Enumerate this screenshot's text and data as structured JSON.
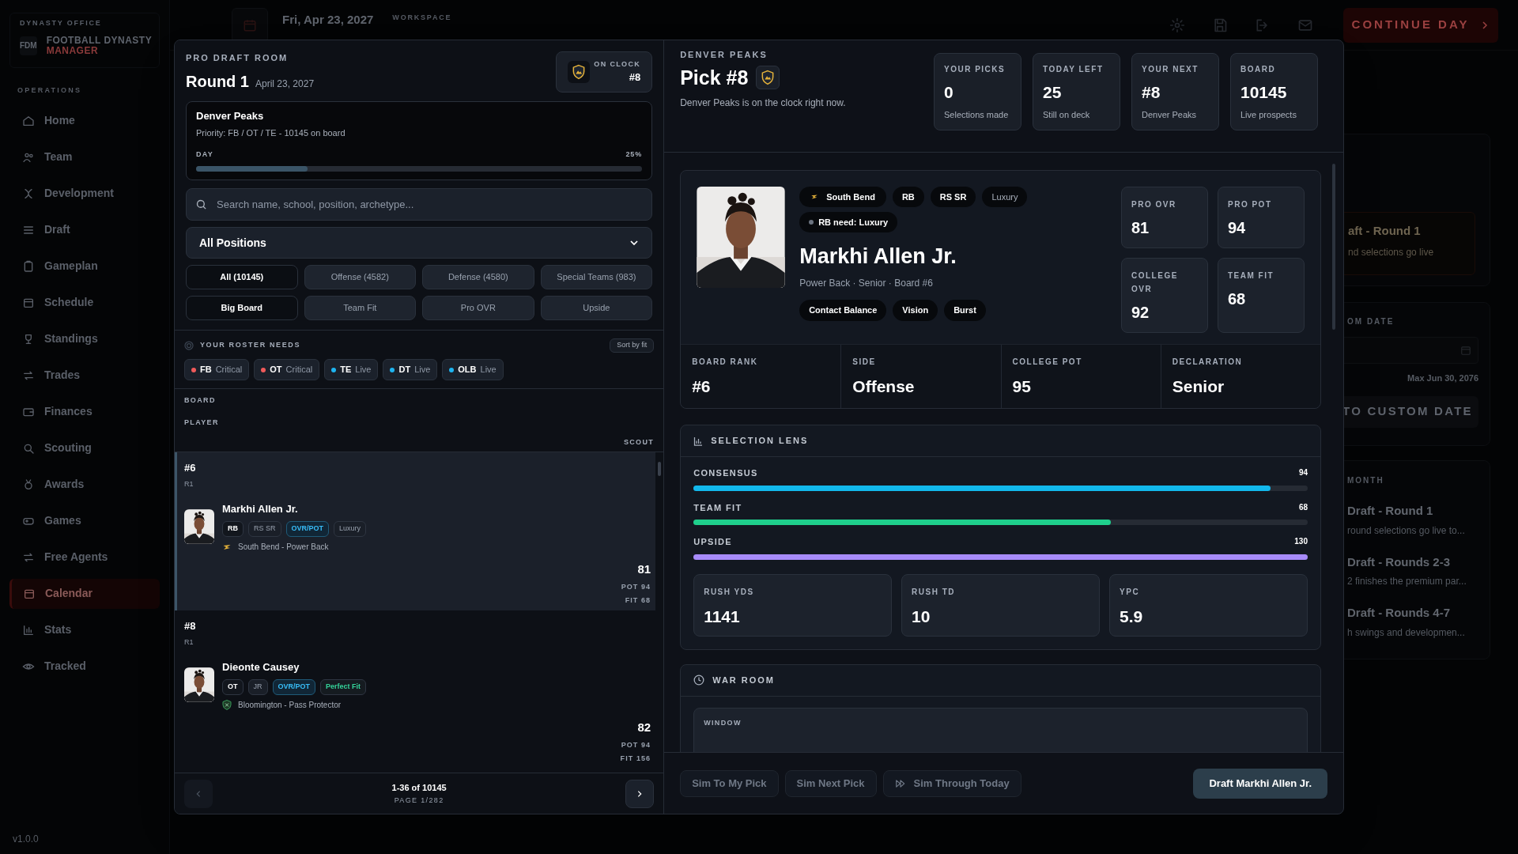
{
  "app": {
    "kicker": "DYNASTY OFFICE",
    "logo": "FDM",
    "brand": "FOOTBALL DYNASTY",
    "brand_sub": "MANAGER",
    "nav_heading": "OPERATIONS",
    "nav": [
      {
        "label": "Home",
        "selected": false
      },
      {
        "label": "Team",
        "selected": false
      },
      {
        "label": "Development",
        "selected": false
      },
      {
        "label": "Draft",
        "selected": false
      },
      {
        "label": "Gameplan",
        "selected": false
      },
      {
        "label": "Schedule",
        "selected": false
      },
      {
        "label": "Standings",
        "selected": false
      },
      {
        "label": "Trades",
        "selected": false
      },
      {
        "label": "Finances",
        "selected": false
      },
      {
        "label": "Scouting",
        "selected": false
      },
      {
        "label": "Awards",
        "selected": false
      },
      {
        "label": "Games",
        "selected": false
      },
      {
        "label": "Free Agents",
        "selected": false
      },
      {
        "label": "Calendar",
        "selected": true
      },
      {
        "label": "Stats",
        "selected": false
      },
      {
        "label": "Tracked",
        "selected": false
      }
    ],
    "version": "v1.0.0"
  },
  "top_bar": {
    "date": "Fri, Apr 23, 2027",
    "workspace_label": "WORKSPACE",
    "continue_button": "CONTINUE DAY"
  },
  "calendar_panel": {
    "event": {
      "title": "aft - Round 1",
      "note": "nd selections go live"
    },
    "custom_date": {
      "heading": "OM DATE",
      "hint": "Max Jun 30, 2076",
      "button": "TO CUSTOM DATE"
    },
    "month": {
      "heading": "MONTH",
      "events": [
        {
          "title": "Draft - Round 1",
          "note": "round selections go live to..."
        },
        {
          "title": "Draft - Rounds 2-3",
          "note": "2 finishes the premium par..."
        },
        {
          "title": "Draft - Rounds 4-7",
          "note": "h swings and developmen..."
        }
      ]
    }
  },
  "draft_room": {
    "kicker": "PRO DRAFT ROOM",
    "title": "Round 1",
    "date": "April 23, 2027",
    "on_clock": {
      "label": "ON CLOCK",
      "pick": "#8"
    },
    "team": {
      "name": "Denver Peaks",
      "priority": "Priority: FB / OT / TE - 10145 on board",
      "day_label": "DAY",
      "day_reading": "25%",
      "level": 0.25
    },
    "search": {
      "placeholder": "Search name, school, position, archetype..."
    },
    "position_select": "All Positions",
    "filters": [
      {
        "label": "All (10145)",
        "selected": true
      },
      {
        "label": "Offense (4582)",
        "selected": false
      },
      {
        "label": "Defense (4580)",
        "selected": false
      },
      {
        "label": "Special Teams (983)",
        "selected": false
      }
    ],
    "sorts": [
      {
        "label": "Big Board",
        "selected": true
      },
      {
        "label": "Team Fit",
        "selected": false
      },
      {
        "label": "Pro OVR",
        "selected": false
      },
      {
        "label": "Upside",
        "selected": false
      }
    ],
    "needs": {
      "heading": "YOUR ROSTER NEEDS",
      "sort_button": "Sort by fit",
      "items": [
        {
          "position": "FB",
          "status": "Critical",
          "color": "#f05a5a"
        },
        {
          "position": "OT",
          "status": "Critical",
          "color": "#f05a5a"
        },
        {
          "position": "TE",
          "status": "Live",
          "color": "#1eb4f0"
        },
        {
          "position": "DT",
          "status": "Live",
          "color": "#1eb4f0"
        },
        {
          "position": "OLB",
          "status": "Live",
          "color": "#1eb4f0"
        }
      ]
    },
    "columns": {
      "board": "BOARD",
      "player": "PLAYER",
      "scout": "SCOUT"
    },
    "rows": [
      {
        "rank": "#6",
        "round": "R1",
        "name": "Markhi Allen Jr.",
        "selected": true,
        "tags": [
          {
            "label": "RB",
            "kind": "position"
          },
          {
            "label": "RS SR",
            "kind": "plain"
          },
          {
            "label": "OVR/POT",
            "kind": "accent"
          },
          {
            "label": "Luxury",
            "kind": "plain"
          }
        ],
        "school": "South Bend - Power Back",
        "ovr": "81",
        "pot": "POT 94",
        "fit": "FIT 68"
      },
      {
        "rank": "#8",
        "round": "R1",
        "name": "Dieonte Causey",
        "selected": false,
        "tags": [
          {
            "label": "OT",
            "kind": "position"
          },
          {
            "label": "JR",
            "kind": "plain"
          },
          {
            "label": "OVR/POT",
            "kind": "accent"
          },
          {
            "label": "Perfect Fit",
            "kind": "fit"
          }
        ],
        "school": "Bloomington - Pass Protector",
        "ovr": "82",
        "pot": "POT 94",
        "fit": "FIT 156"
      }
    ],
    "pager": {
      "range": "1-36 of 10145",
      "page": "PAGE 1/282",
      "prev_disabled": true
    },
    "pick": {
      "kicker": "DENVER PEAKS",
      "title": "Pick #8",
      "note": "Denver Peaks is on the clock right now."
    },
    "stats": [
      {
        "label": "YOUR PICKS",
        "value": "0",
        "sub": "Selections made"
      },
      {
        "label": "TODAY LEFT",
        "value": "25",
        "sub": "Still on deck"
      },
      {
        "label": "YOUR NEXT",
        "value": "#8",
        "sub": "Denver Peaks"
      },
      {
        "label": "BOARD",
        "value": "10145",
        "sub": "Live prospects"
      }
    ],
    "player": {
      "chips": [
        {
          "label": "South Bend",
          "kind": "school"
        },
        {
          "label": "RB",
          "kind": "strong"
        },
        {
          "label": "RS SR",
          "kind": "strong"
        },
        {
          "label": "Luxury",
          "kind": "muted"
        }
      ],
      "need": "RB need: Luxury",
      "name": "Markhi Allen Jr.",
      "subtitle": "Power Back · Senior · Board #6",
      "traits": [
        "Contact Balance",
        "Vision",
        "Burst"
      ],
      "ratings": [
        {
          "label": "PRO OVR",
          "value": "81"
        },
        {
          "label": "PRO POT",
          "value": "94"
        },
        {
          "label": "COLLEGE OVR",
          "value": "92"
        },
        {
          "label": "TEAM FIT",
          "value": "68"
        }
      ],
      "facts": [
        {
          "label": "BOARD RANK",
          "value": "#6"
        },
        {
          "label": "SIDE",
          "value": "Offense"
        },
        {
          "label": "COLLEGE POT",
          "value": "95"
        },
        {
          "label": "DECLARATION",
          "value": "Senior"
        }
      ]
    },
    "lens": {
      "title": "SELECTION LENS",
      "bars": [
        {
          "label": "CONSENSUS",
          "value": "94",
          "level": 0.94,
          "color": "#12b8ec"
        },
        {
          "label": "TEAM FIT",
          "value": "68",
          "level": 0.68,
          "color": "#1fcf8c"
        },
        {
          "label": "UPSIDE",
          "value": "130",
          "level": 1,
          "color": "#a78bfa"
        }
      ],
      "stats": [
        {
          "label": "RUSH YDS",
          "value": "1141"
        },
        {
          "label": "RUSH TD",
          "value": "10"
        },
        {
          "label": "YPC",
          "value": "5.9"
        }
      ]
    },
    "war_room": {
      "title": "WAR ROOM",
      "window_label": "WINDOW"
    },
    "actions": [
      "Sim To My Pick",
      "Sim Next Pick",
      "Sim Through Today"
    ],
    "draft_button": "Draft Markhi Allen Jr."
  }
}
